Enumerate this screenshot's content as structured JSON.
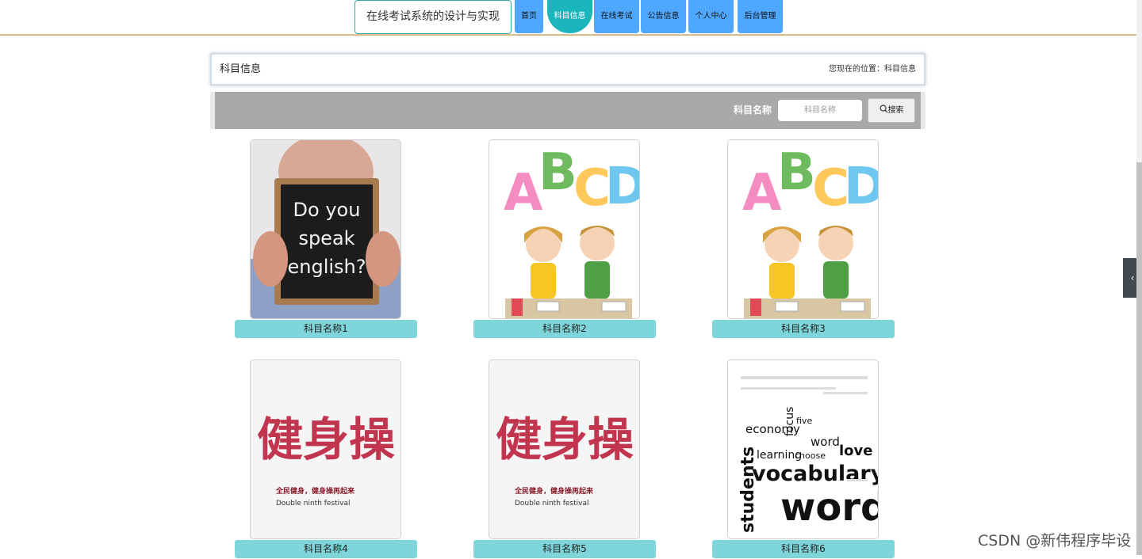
{
  "nav": {
    "brand": "在线考试系统的设计与实现",
    "items": [
      {
        "label": "首页",
        "active": false
      },
      {
        "label": "科目信息",
        "active": true
      },
      {
        "label": "在线考试",
        "active": false
      },
      {
        "label": "公告信息",
        "active": false
      },
      {
        "label": "个人中心",
        "active": false
      },
      {
        "label": "后台管理",
        "active": false
      }
    ]
  },
  "breadcrumb": {
    "title": "科目信息",
    "location": "您现在的位置：科目信息"
  },
  "search": {
    "label": "科目名称",
    "placeholder": "科目名称",
    "button_label": "搜索"
  },
  "cards": [
    {
      "caption": "科目名称1",
      "image": "do-you-speak-english-chalkboard"
    },
    {
      "caption": "科目名称2",
      "image": "abcd-kids-studying"
    },
    {
      "caption": "科目名称3",
      "image": "abcd-kids-studying"
    },
    {
      "caption": "科目名称4",
      "image": "calligraphy-fitness-poster"
    },
    {
      "caption": "科目名称5",
      "image": "calligraphy-fitness-poster"
    },
    {
      "caption": "科目名称6",
      "image": "vocabulary-word-cloud"
    }
  ],
  "images": {
    "chalkboard_text": [
      "Do you",
      "speak",
      "english?"
    ],
    "abcd_letters": [
      "A",
      "B",
      "C",
      "D"
    ],
    "calligraphy_text": "健身操",
    "calligraphy_sub1": "全民健身，健身操再起来",
    "calligraphy_sub2": "Double ninth festival",
    "wordcloud_words": [
      "vocabulary",
      "words",
      "students",
      "learning",
      "economy",
      "love",
      "word",
      "choose",
      "focus",
      "five"
    ]
  },
  "side_handle": {
    "icon": "chevron-left-icon",
    "glyph": "‹"
  },
  "watermark": "CSDN @新伟程序毕设",
  "colors": {
    "nav_blue": "#4fa8ff",
    "nav_active": "#1ab6bc",
    "caption_bg": "#7fd6da",
    "search_bar_bg": "#a9a9a9"
  }
}
